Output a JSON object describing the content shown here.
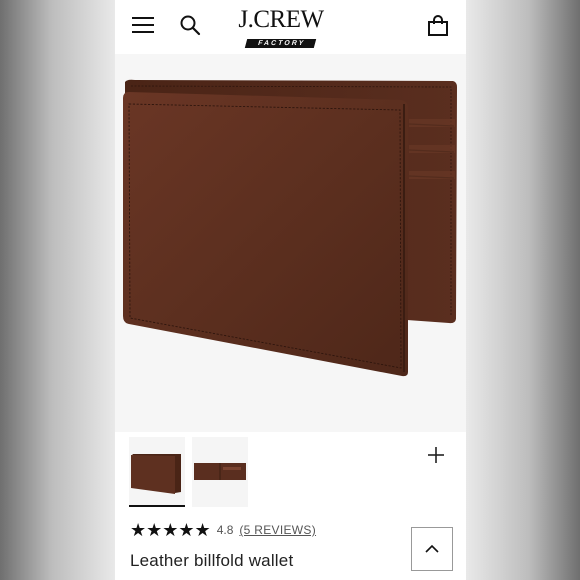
{
  "header": {
    "menu_icon": "hamburger-menu-icon",
    "search_icon": "search-icon",
    "logo_main": "J.CREW",
    "logo_sub": "FACTORY",
    "bag_icon": "shopping-bag-icon"
  },
  "product": {
    "image_subject": "brown leather billfold wallet",
    "zoom_icon": "plus-icon",
    "thumbnails": [
      "front view",
      "open view"
    ],
    "active_thumbnail": 1,
    "rating": {
      "stars": "★★★★★",
      "value": "4.8",
      "reviews_label": "(5 REVIEWS)"
    },
    "title": "Leather billfold wallet"
  },
  "scroll_top_icon": "chevron-up-icon",
  "colors": {
    "leather": "#5a2e1f",
    "leather_light": "#6e3a28",
    "stitch": "#2e150d",
    "text_dark": "#111111"
  }
}
